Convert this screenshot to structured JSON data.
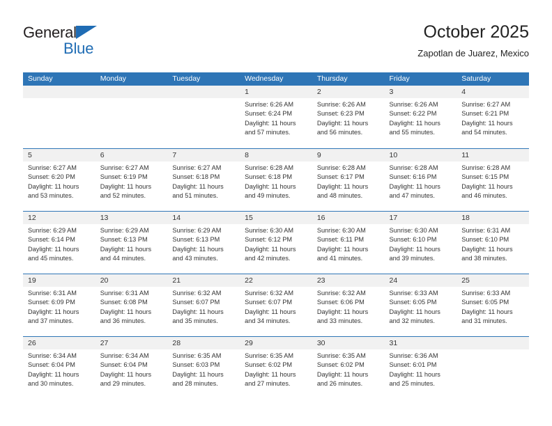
{
  "brand": {
    "name_part1": "General",
    "name_part2": "Blue",
    "triangle_icon": "triangle-icon",
    "color_dark": "#231f20",
    "color_blue": "#1f6cb4"
  },
  "header": {
    "title": "October 2025",
    "subtitle": "Zapotlan de Juarez, Mexico"
  },
  "calendar": {
    "accent_color": "#2e75b6",
    "day_band_color": "#f1f1f1",
    "weekday_headers": [
      "Sunday",
      "Monday",
      "Tuesday",
      "Wednesday",
      "Thursday",
      "Friday",
      "Saturday"
    ],
    "weeks": [
      [
        {
          "date": "",
          "lines": []
        },
        {
          "date": "",
          "lines": []
        },
        {
          "date": "",
          "lines": []
        },
        {
          "date": "1",
          "lines": [
            "Sunrise: 6:26 AM",
            "Sunset: 6:24 PM",
            "Daylight: 11 hours",
            "and 57 minutes."
          ]
        },
        {
          "date": "2",
          "lines": [
            "Sunrise: 6:26 AM",
            "Sunset: 6:23 PM",
            "Daylight: 11 hours",
            "and 56 minutes."
          ]
        },
        {
          "date": "3",
          "lines": [
            "Sunrise: 6:26 AM",
            "Sunset: 6:22 PM",
            "Daylight: 11 hours",
            "and 55 minutes."
          ]
        },
        {
          "date": "4",
          "lines": [
            "Sunrise: 6:27 AM",
            "Sunset: 6:21 PM",
            "Daylight: 11 hours",
            "and 54 minutes."
          ]
        }
      ],
      [
        {
          "date": "5",
          "lines": [
            "Sunrise: 6:27 AM",
            "Sunset: 6:20 PM",
            "Daylight: 11 hours",
            "and 53 minutes."
          ]
        },
        {
          "date": "6",
          "lines": [
            "Sunrise: 6:27 AM",
            "Sunset: 6:19 PM",
            "Daylight: 11 hours",
            "and 52 minutes."
          ]
        },
        {
          "date": "7",
          "lines": [
            "Sunrise: 6:27 AM",
            "Sunset: 6:18 PM",
            "Daylight: 11 hours",
            "and 51 minutes."
          ]
        },
        {
          "date": "8",
          "lines": [
            "Sunrise: 6:28 AM",
            "Sunset: 6:18 PM",
            "Daylight: 11 hours",
            "and 49 minutes."
          ]
        },
        {
          "date": "9",
          "lines": [
            "Sunrise: 6:28 AM",
            "Sunset: 6:17 PM",
            "Daylight: 11 hours",
            "and 48 minutes."
          ]
        },
        {
          "date": "10",
          "lines": [
            "Sunrise: 6:28 AM",
            "Sunset: 6:16 PM",
            "Daylight: 11 hours",
            "and 47 minutes."
          ]
        },
        {
          "date": "11",
          "lines": [
            "Sunrise: 6:28 AM",
            "Sunset: 6:15 PM",
            "Daylight: 11 hours",
            "and 46 minutes."
          ]
        }
      ],
      [
        {
          "date": "12",
          "lines": [
            "Sunrise: 6:29 AM",
            "Sunset: 6:14 PM",
            "Daylight: 11 hours",
            "and 45 minutes."
          ]
        },
        {
          "date": "13",
          "lines": [
            "Sunrise: 6:29 AM",
            "Sunset: 6:13 PM",
            "Daylight: 11 hours",
            "and 44 minutes."
          ]
        },
        {
          "date": "14",
          "lines": [
            "Sunrise: 6:29 AM",
            "Sunset: 6:13 PM",
            "Daylight: 11 hours",
            "and 43 minutes."
          ]
        },
        {
          "date": "15",
          "lines": [
            "Sunrise: 6:30 AM",
            "Sunset: 6:12 PM",
            "Daylight: 11 hours",
            "and 42 minutes."
          ]
        },
        {
          "date": "16",
          "lines": [
            "Sunrise: 6:30 AM",
            "Sunset: 6:11 PM",
            "Daylight: 11 hours",
            "and 41 minutes."
          ]
        },
        {
          "date": "17",
          "lines": [
            "Sunrise: 6:30 AM",
            "Sunset: 6:10 PM",
            "Daylight: 11 hours",
            "and 39 minutes."
          ]
        },
        {
          "date": "18",
          "lines": [
            "Sunrise: 6:31 AM",
            "Sunset: 6:10 PM",
            "Daylight: 11 hours",
            "and 38 minutes."
          ]
        }
      ],
      [
        {
          "date": "19",
          "lines": [
            "Sunrise: 6:31 AM",
            "Sunset: 6:09 PM",
            "Daylight: 11 hours",
            "and 37 minutes."
          ]
        },
        {
          "date": "20",
          "lines": [
            "Sunrise: 6:31 AM",
            "Sunset: 6:08 PM",
            "Daylight: 11 hours",
            "and 36 minutes."
          ]
        },
        {
          "date": "21",
          "lines": [
            "Sunrise: 6:32 AM",
            "Sunset: 6:07 PM",
            "Daylight: 11 hours",
            "and 35 minutes."
          ]
        },
        {
          "date": "22",
          "lines": [
            "Sunrise: 6:32 AM",
            "Sunset: 6:07 PM",
            "Daylight: 11 hours",
            "and 34 minutes."
          ]
        },
        {
          "date": "23",
          "lines": [
            "Sunrise: 6:32 AM",
            "Sunset: 6:06 PM",
            "Daylight: 11 hours",
            "and 33 minutes."
          ]
        },
        {
          "date": "24",
          "lines": [
            "Sunrise: 6:33 AM",
            "Sunset: 6:05 PM",
            "Daylight: 11 hours",
            "and 32 minutes."
          ]
        },
        {
          "date": "25",
          "lines": [
            "Sunrise: 6:33 AM",
            "Sunset: 6:05 PM",
            "Daylight: 11 hours",
            "and 31 minutes."
          ]
        }
      ],
      [
        {
          "date": "26",
          "lines": [
            "Sunrise: 6:34 AM",
            "Sunset: 6:04 PM",
            "Daylight: 11 hours",
            "and 30 minutes."
          ]
        },
        {
          "date": "27",
          "lines": [
            "Sunrise: 6:34 AM",
            "Sunset: 6:04 PM",
            "Daylight: 11 hours",
            "and 29 minutes."
          ]
        },
        {
          "date": "28",
          "lines": [
            "Sunrise: 6:35 AM",
            "Sunset: 6:03 PM",
            "Daylight: 11 hours",
            "and 28 minutes."
          ]
        },
        {
          "date": "29",
          "lines": [
            "Sunrise: 6:35 AM",
            "Sunset: 6:02 PM",
            "Daylight: 11 hours",
            "and 27 minutes."
          ]
        },
        {
          "date": "30",
          "lines": [
            "Sunrise: 6:35 AM",
            "Sunset: 6:02 PM",
            "Daylight: 11 hours",
            "and 26 minutes."
          ]
        },
        {
          "date": "31",
          "lines": [
            "Sunrise: 6:36 AM",
            "Sunset: 6:01 PM",
            "Daylight: 11 hours",
            "and 25 minutes."
          ]
        },
        {
          "date": "",
          "lines": []
        }
      ]
    ]
  }
}
